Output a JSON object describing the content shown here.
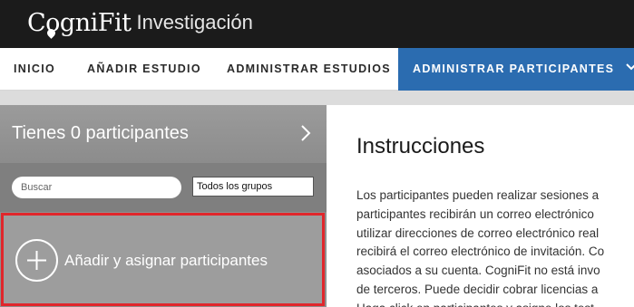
{
  "header": {
    "brand": "CogniFit",
    "subtitle": "Investigación",
    "bg_color": "#1b1b1b"
  },
  "nav": {
    "items": [
      {
        "label": "INICIO"
      },
      {
        "label": "AÑADIR ESTUDIO"
      },
      {
        "label": "ADMINISTRAR ESTUDIOS"
      },
      {
        "label": "ADMINISTRAR PARTICIPANTES",
        "active": true,
        "icon": "chevron-down-icon"
      }
    ],
    "active_color": "#2b6cb0"
  },
  "sidebar": {
    "participants_count_text": "Tienes 0 participantes",
    "search_placeholder": "Buscar",
    "group_filter_value": "Todos los grupos",
    "add_button_label": "Añadir y asignar participantes",
    "highlight_color": "#e0262b"
  },
  "main": {
    "title": "Instrucciones",
    "lines": [
      "Los participantes pueden realizar sesiones a",
      "participantes recibirán un correo electrónico",
      "utilizar direcciones de correo electrónico real",
      "recibirá el correo electrónico de invitación. Co",
      "asociados a su cuenta. CogniFit no está invo",
      "de terceros. Puede decidir cobrar licencias a",
      "Haga click en participantes y asigne los test"
    ]
  }
}
